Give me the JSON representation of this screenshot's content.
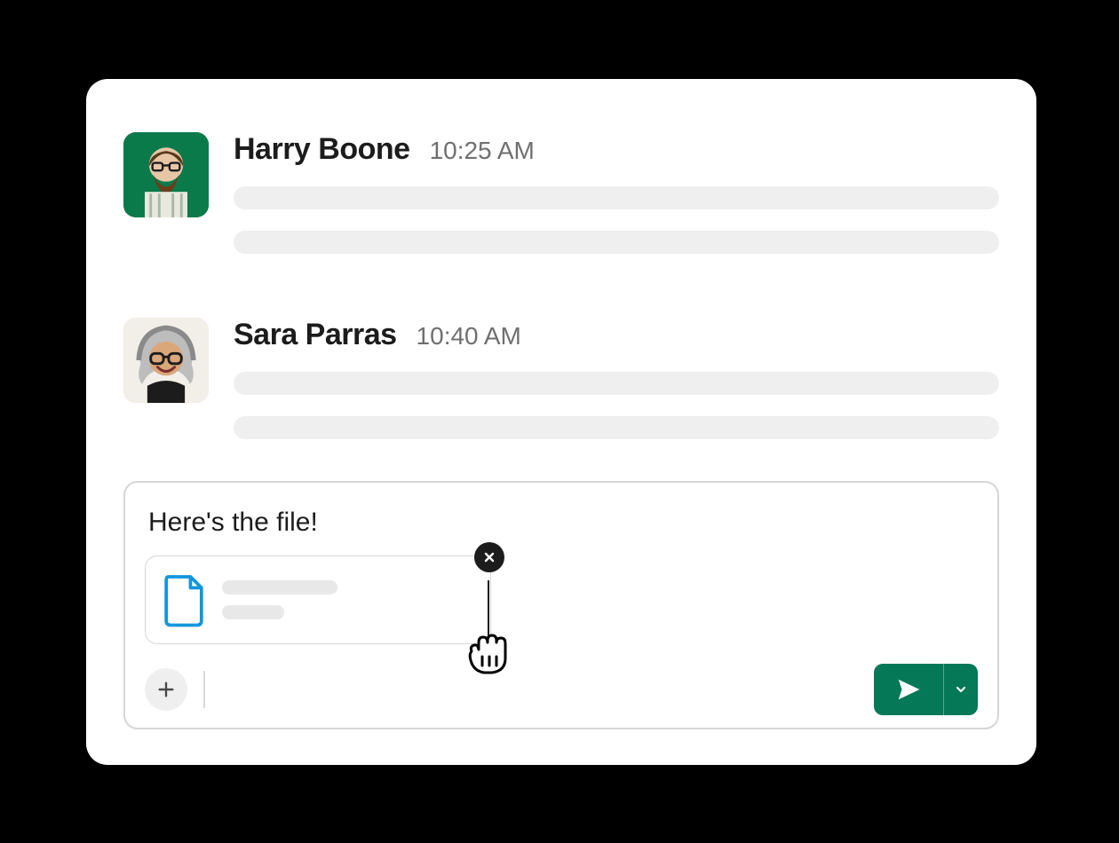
{
  "messages": [
    {
      "name": "Harry Boone",
      "time": "10:25 AM"
    },
    {
      "name": "Sara Parras",
      "time": "10:40 AM"
    }
  ],
  "composer": {
    "text": "Here's the file!"
  },
  "colors": {
    "send_button": "#047857"
  }
}
